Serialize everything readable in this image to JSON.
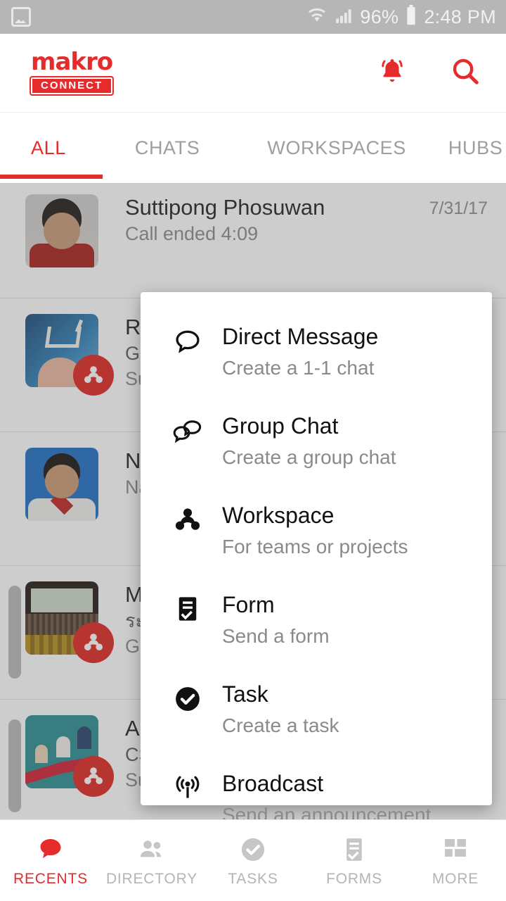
{
  "status_bar": {
    "photo_icon": "photo-icon",
    "wifi_icon": "wifi-icon",
    "signal_icon": "signal-bars-icon",
    "battery_percent": "96%",
    "battery_icon": "battery-icon",
    "time": "2:48 PM"
  },
  "app_bar": {
    "logo_primary": "makro",
    "logo_secondary": "CONNECT",
    "notifications_icon": "bell-icon",
    "search_icon": "search-icon"
  },
  "tabs": {
    "items": [
      {
        "label": "ALL",
        "active": true
      },
      {
        "label": "CHATS",
        "active": false
      },
      {
        "label": "WORKSPACES",
        "active": false
      },
      {
        "label": "HUBS",
        "active": false
      }
    ],
    "accent_color": "#e52b2b"
  },
  "list": {
    "rows": [
      {
        "title": "Suttipong Phosuwan",
        "subtitle": "Call ended 4:09",
        "subtitle2": "",
        "date": "7/31/17",
        "avatar": "person-photo",
        "badge": false,
        "unread": false
      },
      {
        "title": "Re",
        "subtitle": "Ge",
        "subtitle2": "Su",
        "date": "",
        "avatar": "shopping-cart-photo",
        "badge": true,
        "unread": false
      },
      {
        "title": "Na",
        "subtitle": "Na",
        "subtitle2": "",
        "date": "",
        "avatar": "person-photo",
        "badge": false,
        "unread": false
      },
      {
        "title": "M",
        "subtitle": "ระบ",
        "subtitle2": "Ge",
        "date": "",
        "avatar": "auditorium-photo",
        "badge": true,
        "unread": true
      },
      {
        "title": "AP",
        "subtitle": "CS",
        "subtitle2": "Su",
        "date": "",
        "avatar": "teamwork-illustration",
        "badge": true,
        "unread": true
      }
    ],
    "badge_icon": "workspace-icon",
    "badge_color": "#e0261f"
  },
  "create_menu": {
    "items": [
      {
        "label": "Direct Message",
        "desc": "Create a 1-1 chat",
        "icon": "chat-bubble-icon"
      },
      {
        "label": "Group Chat",
        "desc": "Create a group chat",
        "icon": "double-chat-bubble-icon"
      },
      {
        "label": "Workspace",
        "desc": "For teams or projects",
        "icon": "workspace-icon"
      },
      {
        "label": "Form",
        "desc": "Send a form",
        "icon": "form-icon"
      },
      {
        "label": "Task",
        "desc": "Create a task",
        "icon": "check-circle-icon"
      },
      {
        "label": "Broadcast",
        "desc": "Send an announcement",
        "icon": "broadcast-icon"
      }
    ]
  },
  "bottom_nav": {
    "items": [
      {
        "label": "RECENTS",
        "icon": "speech-bubble-icon",
        "active": true
      },
      {
        "label": "DIRECTORY",
        "icon": "people-icon",
        "active": false
      },
      {
        "label": "TASKS",
        "icon": "check-circle-icon",
        "active": false
      },
      {
        "label": "FORMS",
        "icon": "form-icon",
        "active": false
      },
      {
        "label": "MORE",
        "icon": "grid-icon",
        "active": false
      }
    ],
    "active_color": "#e52b2b",
    "inactive_color": "#b4b4b4"
  }
}
